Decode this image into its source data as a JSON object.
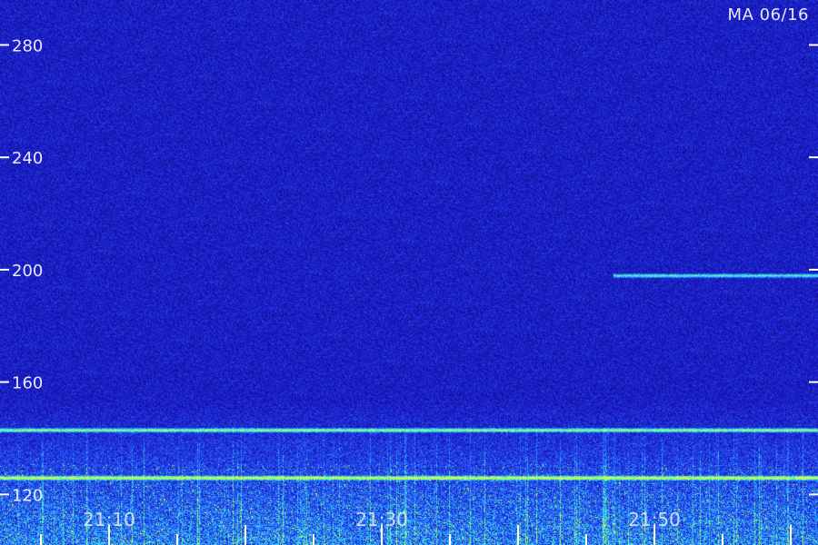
{
  "header": {
    "station_date": "MA 06/16"
  },
  "chart_data": {
    "type": "heatmap",
    "title": "",
    "xlabel": "",
    "ylabel": "",
    "y_ticks": [
      280,
      240,
      200,
      160,
      120
    ],
    "ylim": [
      102,
      296
    ],
    "x_ticks": [
      "21:10",
      "21:30",
      "21:50"
    ],
    "x_tick_positions_min": [
      10,
      30,
      50
    ],
    "xlim_min": [
      2,
      62
    ],
    "minor_tick_interval_min": 5,
    "colormap": [
      "#12066a",
      "#1a1acc",
      "#2c6cff",
      "#2ee6ff",
      "#7aff6a",
      "#e6ff3a"
    ],
    "features": [
      {
        "name": "band",
        "y": 143,
        "x_start_min": 2,
        "x_end_min": 62,
        "intensity": 0.72
      },
      {
        "name": "band",
        "y": 126,
        "x_start_min": 2,
        "x_end_min": 62,
        "intensity": 0.85
      },
      {
        "name": "band",
        "y": 198,
        "x_start_min": 47,
        "x_end_min": 62,
        "intensity": 0.6
      }
    ],
    "grid": false
  }
}
